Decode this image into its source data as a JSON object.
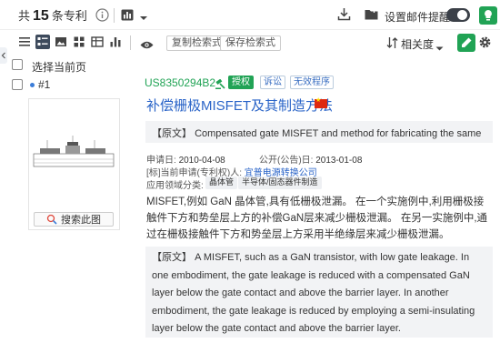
{
  "header": {
    "count_prefix": "共",
    "count": "15",
    "count_suffix": "条专利",
    "mail_alert_label": "设置邮件提醒"
  },
  "toolbar": {
    "copy_query_label": "复制检索式",
    "save_query_label": "保存检索式",
    "sort_label": "相关度"
  },
  "list": {
    "select_all_label": "选择当前页",
    "items": [
      {
        "rank": "#1",
        "pub_number": "US8350294B2",
        "status_tags": [
          "授权",
          "诉讼",
          "无效程序"
        ],
        "title": "补偿栅极MISFET及其制造方法",
        "original_title_prefix": "【原文】",
        "original_title": "Compensated gate MISFET and method for fabricating the same",
        "filing_date_label": "申请日:",
        "filing_date": "2010-04-08",
        "pub_date_label": "公开(公告)日:",
        "pub_date": "2013-01-08",
        "applicant_label": "[标]当前申请(专利权)人:",
        "applicant": "宜普电源转换公司",
        "domain_label": "应用领域分类:",
        "domain_tags": [
          "晶体管",
          "半导体/固态器件制造"
        ],
        "image_search_label": "搜索此图",
        "abstract_cn": "MISFET,例如 GaN 晶体管,具有低栅极泄漏。 在一个实施例中,利用栅极接触件下方和势垒层上方的补偿GaN层来减少栅极泄漏。 在另一实施例中,通过在栅极接触件下方和势垒层上方采用半绝缘层来减少栅极泄漏。",
        "abstract_en_prefix": "【原文】",
        "abstract_en": "A MISFET, such as a GaN transistor, with low gate leakage. In one embodiment, the gate leakage is reduced with a compensated GaN layer below the gate contact and above the barrier layer. In another embodiment, the gate leakage is reduced by employing a semi-insulating layer below the gate contact and above the barrier layer."
      }
    ]
  },
  "colors": {
    "accent_green": "#21a355",
    "link_blue": "#2a64c8"
  }
}
